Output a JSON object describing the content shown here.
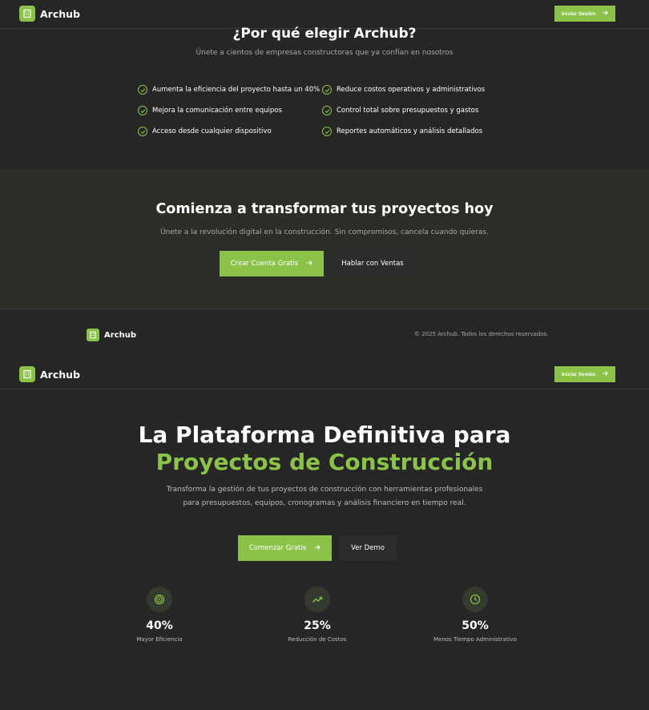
{
  "brand": {
    "name": "Archub",
    "accent": "#8bc34a",
    "logo_icon": "building-icon"
  },
  "nav": {
    "login_label": "Iniciar Sesión",
    "login_icon": "arrow-right-icon"
  },
  "why": {
    "title": "¿Por qué elegir Archub?",
    "subtitle": "Únete a cientos de empresas constructoras que ya confían en nosotros",
    "benefits": [
      "Aumenta la eficiencia del proyecto hasta un 40%",
      "Reduce costos operativos y administrativos",
      "Mejora la comunicación entre equipos",
      "Control total sobre presupuestos y gastos",
      "Acceso desde cualquier dispositivo",
      "Reportes automáticos y análisis detallados"
    ]
  },
  "cta": {
    "title": "Comienza a transformar tus proyectos hoy",
    "subtitle": "Únete a la revolución digital en la construcción. Sin compromisos, cancela cuando quieras.",
    "primary_label": "Crear Cuenta Gratis",
    "secondary_label": "Hablar con Ventas"
  },
  "footer": {
    "copyright": "© 2025 Archub. Todos los derechos reservados."
  },
  "hero": {
    "title_line1": "La Plataforma Definitiva para",
    "title_line2": "Proyectos de Construcción",
    "description": "Transforma la gestión de tus proyectos de construcción con herramientas profesionales para presupuestos, equipos, cronogramas y análisis financiero en tiempo real.",
    "primary_label": "Comenzar Gratis",
    "secondary_label": "Ver Demo"
  },
  "stats": [
    {
      "icon": "target-icon",
      "value": "40%",
      "label": "Mayor Eficiencia"
    },
    {
      "icon": "trending-up-icon",
      "value": "25%",
      "label": "Reducción de Costos"
    },
    {
      "icon": "clock-icon",
      "value": "50%",
      "label": "Menos Tiempo Administrativo"
    }
  ]
}
